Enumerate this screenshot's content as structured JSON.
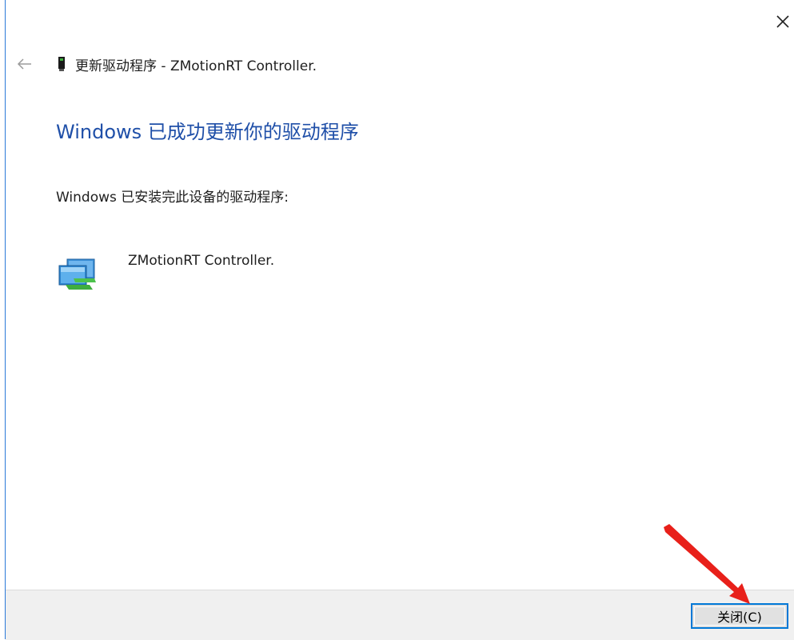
{
  "header": {
    "title": "更新驱动程序 - ZMotionRT Controller."
  },
  "main": {
    "heading": "Windows 已成功更新你的驱动程序",
    "subtext": "Windows 已安装完此设备的驱动程序:",
    "device_name": "ZMotionRT Controller."
  },
  "footer": {
    "close_label": "关闭(C)"
  },
  "icons": {
    "close": "close-icon",
    "back": "back-arrow-icon",
    "device_small": "device-icon",
    "network_device": "network-adapter-icon"
  },
  "colors": {
    "heading": "#1f4fa8",
    "button_border": "#0078d7",
    "footer_bg": "#f0f0f0",
    "annotation_arrow": "#e8201a"
  }
}
